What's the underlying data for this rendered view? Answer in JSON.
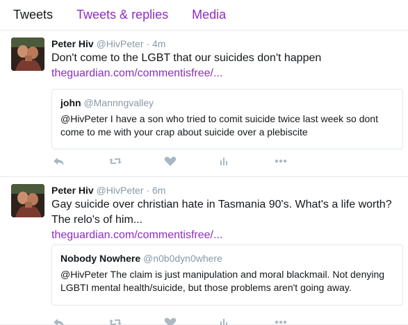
{
  "tabs": [
    {
      "label": "Tweets",
      "active": true
    },
    {
      "label": "Tweets & replies",
      "active": false
    },
    {
      "label": "Media",
      "active": false
    }
  ],
  "tweets": [
    {
      "name": "Peter Hiv",
      "handle": "@HivPeter",
      "separator": "·",
      "time": "4m",
      "text": "Don't come to the LGBT that our suicides don't happen",
      "link": "theguardian.com/commentisfree/...",
      "quote": {
        "name": "john",
        "handle": "@Mannngvalley",
        "text": "@HivPeter I have a son who tried to comit suicide twice last week so dont come to me with your crap about suicide over a plebiscite"
      },
      "actions": [
        "reply-icon",
        "retweet-icon",
        "like-icon",
        "analytics-icon",
        "more-icon"
      ]
    },
    {
      "name": "Peter Hiv",
      "handle": "@HivPeter",
      "separator": "·",
      "time": "6m",
      "text": "Gay suicide over christian hate in Tasmania 90's. What's a life worth? The relo's of him...",
      "link": "theguardian.com/commentisfree/...",
      "quote": {
        "name": "Nobody Nowhere",
        "handle": "@n0b0dyn0where",
        "text": "@HivPeter The claim is just manipulation and moral blackmail. Not denying LGBTI mental health/suicide, but those problems aren't going away."
      },
      "actions": [
        "reply-icon",
        "retweet-icon",
        "like-icon",
        "analytics-icon",
        "more-icon"
      ]
    }
  ],
  "colors": {
    "accent": "#8e2bc4",
    "muted": "#8899a6",
    "icon": "#aab8c2",
    "border": "#e6ecf0"
  }
}
